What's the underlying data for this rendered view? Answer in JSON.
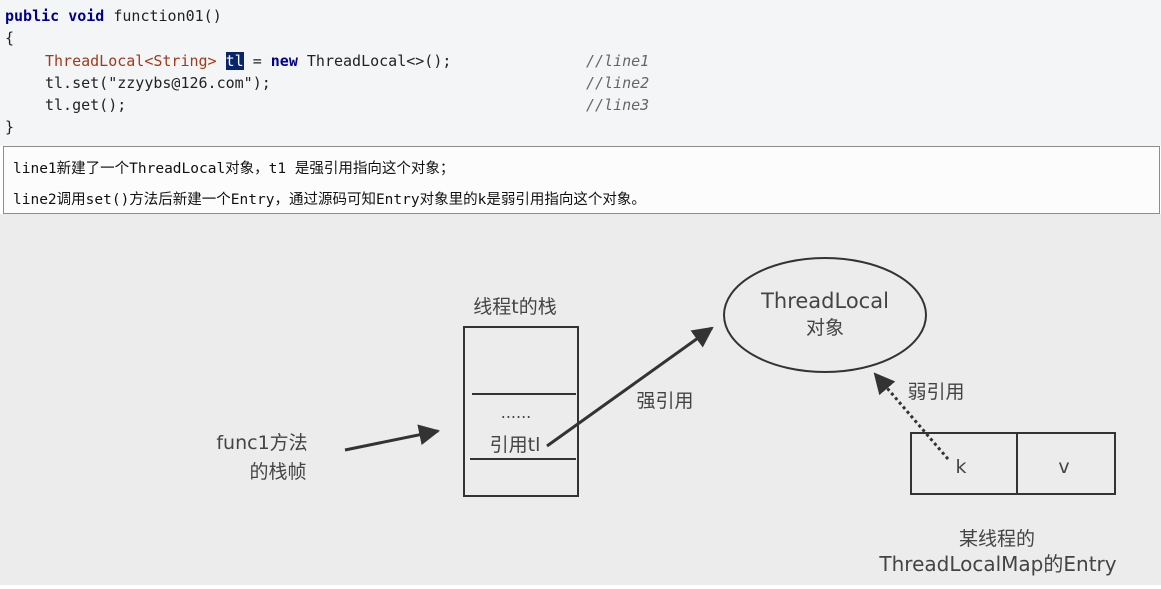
{
  "code": {
    "signature_kw": "public void",
    "signature_name": " function01()",
    "open_brace": "{",
    "line1_type": "ThreadLocal<String>",
    "line1_var": "tl",
    "line1_eq": " = ",
    "line1_new": "new",
    "line1_rest": " ThreadLocal<>();",
    "line2": "tl.set(\"zzyybs@126.com\");",
    "line3": "tl.get();",
    "close_brace": "}",
    "comments": [
      "//line1",
      "//line2",
      "//line3"
    ]
  },
  "notes": [
    "line1新建了一个ThreadLocal对象，t1 是强引用指向这个对象；",
    "line2调用set()方法后新建一个Entry，通过源码可知Entry对象里的k是弱引用指向这个对象。"
  ],
  "diagram": {
    "stack_title": "线程t的栈",
    "stack_dots": "......",
    "stack_ref": "引用tl",
    "frame_label_1": "func1方法",
    "frame_label_2": "的栈帧",
    "strong_ref": "强引用",
    "threadlocal_1": "ThreadLocal",
    "threadlocal_2": "对象",
    "weak_ref": "弱引用",
    "entry_k": "k",
    "entry_v": "v",
    "entry_caption_1": "某线程的",
    "entry_caption_2": "ThreadLocalMap的Entry"
  },
  "colors": {
    "keyword": "#00008b",
    "type": "#a03a1a",
    "highlight_bg": "#0a246a",
    "diagram_bg": "#ececec"
  }
}
